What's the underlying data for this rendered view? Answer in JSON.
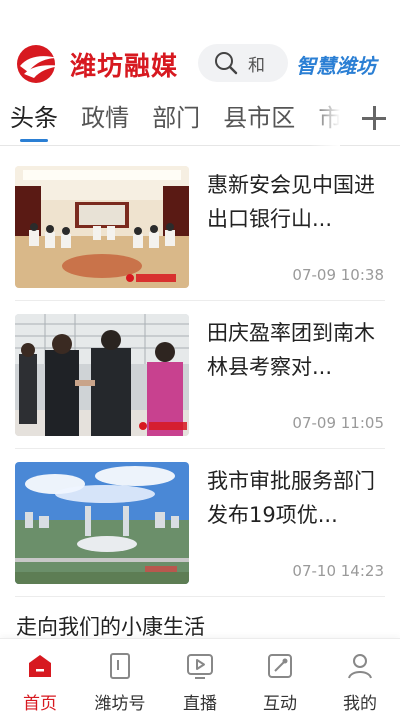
{
  "header": {
    "logo_text": "潍坊融媒",
    "search_placeholder": "和",
    "brand_right": "智慧潍坊"
  },
  "tabs": [
    {
      "label": "头条",
      "active": true
    },
    {
      "label": "政情",
      "active": false
    },
    {
      "label": "部门",
      "active": false
    },
    {
      "label": "县市区",
      "active": false
    },
    {
      "label": "市",
      "active": false
    }
  ],
  "news": [
    {
      "title": "惠新安会见中国进出口银行山...",
      "time": "07-09 10:38",
      "image": "meeting-room-photo"
    },
    {
      "title": "田庆盈率团到南木林县考察对...",
      "time": "07-09 11:05",
      "image": "handshake-photo"
    },
    {
      "title": "我市审批服务部门发布19项优...",
      "time": "07-10 14:23",
      "image": "city-aerial-photo"
    }
  ],
  "plain_item": {
    "title": "走向我们的小康生活"
  },
  "bottom_nav": [
    {
      "label": "首页",
      "icon": "home-icon",
      "active": true
    },
    {
      "label": "潍坊号",
      "icon": "bookmark-icon",
      "active": false
    },
    {
      "label": "直播",
      "icon": "live-tv-icon",
      "active": false
    },
    {
      "label": "互动",
      "icon": "interaction-icon",
      "active": false
    },
    {
      "label": "我的",
      "icon": "profile-icon",
      "active": false
    }
  ],
  "colors": {
    "brand_red": "#d71920",
    "accent_blue": "#2b7fd4",
    "muted": "#9a9a9a"
  }
}
